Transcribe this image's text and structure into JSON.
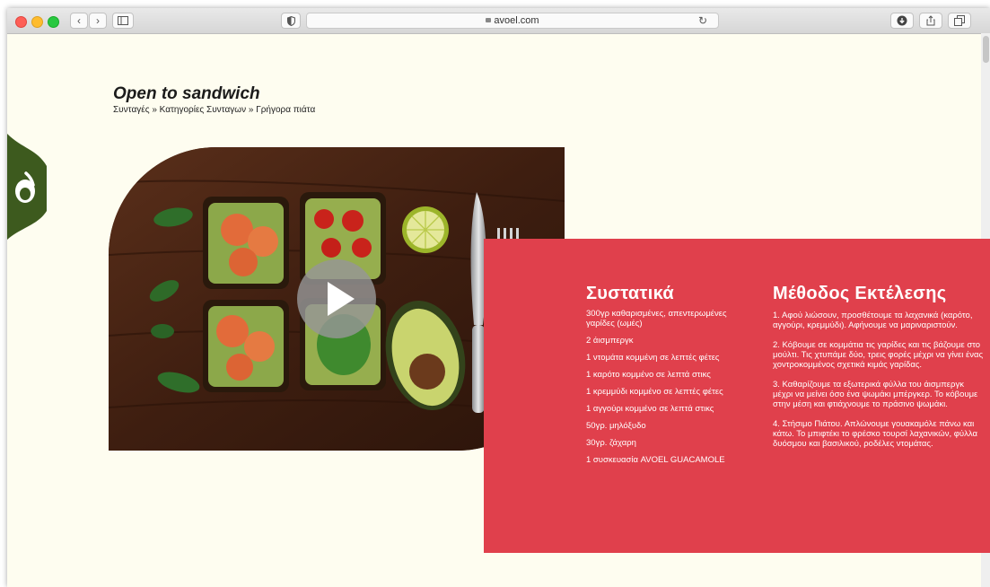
{
  "browser": {
    "url": "avoel.com"
  },
  "page": {
    "title": "Open to sandwich",
    "breadcrumb": [
      "Συνταγές",
      "Κατηγορίες Συνταγων",
      "Γρήγορα πιάτα"
    ],
    "breadcrumb_separator": "»"
  },
  "ingredients": {
    "heading": "Συστατικά",
    "items": [
      "300γρ καθαρισμένες, απεντερωμένες γαρίδες (ωμές)",
      "2 άισμπεργκ",
      "1 ντομάτα κομμένη σε λεπτές φέτες",
      "1 καρότο κομμένο σε λεπτά στικς",
      "1 κρεμμύδι κομμένο σε λεπτές φέτες",
      "1 αγγούρι κομμένο σε λεπτά στικς",
      "50γρ. μηλόξυδο",
      "30γρ. ζάχαρη",
      "1 συσκευασία AVOEL GUACAMOLE"
    ]
  },
  "method": {
    "heading": "Μέθοδος Εκτέλεσης",
    "steps": [
      "1. Αφού λιώσουν, προσθέτουμε τα λαχανικά (καρότο, αγγούρι, κρεμμύδι). Αφήνουμε να μαριναριστούν.",
      "2. Κόβουμε σε κομμάτια τις γαρίδες και τις βάζουμε στο μούλτι. Τις χτυπάμε δύο, τρεις φορές μέχρι να γίνει ένας χοντροκομμένος σχετικά κιμάς γαρίδας.",
      "3. Καθαρίζουμε τα εξωτερικά φύλλα του άισμπεργκ μέχρι να μείνει όσο ένα ψωμάκι μπέργκερ. Το κόβουμε στην μέση και φτιάχνουμε το πράσινο ψωμάκι.",
      "4. Στήσιμο Πιάτου. Απλώνουμε γουακαμόλε πάνω και κάτω. Το μπιφτέκι το φρέσκο τουρσί λαχανικών, φύλλα δυόσμου και βασιλικού, ροδέλες ντομάτας."
    ]
  },
  "colors": {
    "page_background": "#fefdf0",
    "accent_red": "#e0404c",
    "logo_green": "#3d5a1e"
  },
  "icons": [
    "back-icon",
    "forward-icon",
    "sidebar-icon",
    "shield-icon",
    "lock-icon",
    "reload-icon",
    "download-icon",
    "share-icon",
    "tabs-icon",
    "play-icon",
    "avoel-logo-icon"
  ]
}
